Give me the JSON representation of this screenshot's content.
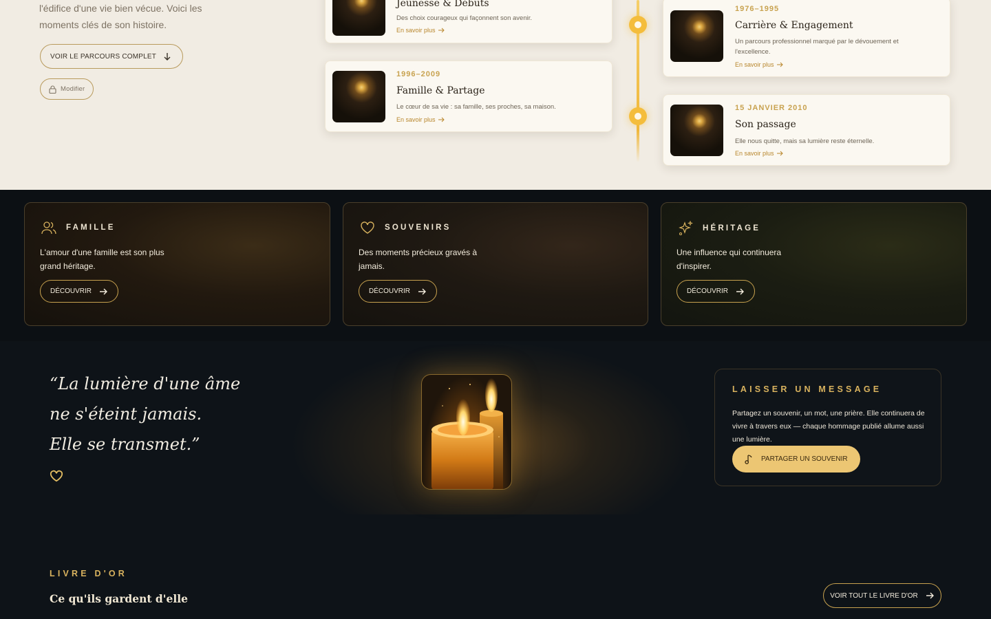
{
  "intro": {
    "text": "l'édifice d'une vie bien vécue. Voici les moments clés de son histoire."
  },
  "actions": {
    "parcours_label": "VOIR LE PARCOURS COMPLET",
    "modifier_label": "Modifier"
  },
  "timeline": {
    "more_label": "En savoir plus",
    "left": [
      {
        "title": "Jeunesse & Débuts",
        "desc": "Des choix courageux qui façonnent son avenir."
      },
      {
        "date": "1996–2009",
        "title": "Famille & Partage",
        "desc": "Le cœur de sa vie : sa famille, ses proches, sa maison."
      }
    ],
    "right": [
      {
        "date": "1976–1995",
        "title": "Carrière & Engagement",
        "desc": "Un parcours professionnel marqué par le dévouement et l'excellence."
      },
      {
        "date": "15 JANVIER 2010",
        "title": "Son passage",
        "desc": "Elle nous quitte, mais sa lumière reste éternelle."
      }
    ]
  },
  "features": {
    "button_label": "DÉCOUVRIR",
    "items": [
      {
        "label": "FAMILLE",
        "icon": "users-icon",
        "text": "L'amour d'une famille est son plus grand héritage."
      },
      {
        "label": "SOUVENIRS",
        "icon": "heart-icon",
        "text": "Des moments précieux gravés à jamais."
      },
      {
        "label": "HÉRITAGE",
        "icon": "sparkles-icon",
        "text": "Une influence qui continuera d'inspirer."
      }
    ]
  },
  "quote": {
    "text": "“La lumière d'une âme\nne s'éteint jamais.\nElle se transmet.”"
  },
  "message": {
    "title": "LAISSER UN MESSAGE",
    "text": "Partagez un souvenir, un mot, une prière. Elle continuera de vivre à travers eux — chaque hommage publié allume aussi une lumière.",
    "button_label": "PARTAGER UN SOUVENIR"
  },
  "livre": {
    "label": "LIVRE D'OR",
    "title": "Ce qu'ils gardent d'elle",
    "button_label": "VOIR TOUT LE LIVRE D'OR"
  },
  "colors": {
    "gold": "#c8a24f",
    "cream": "#f1ece3",
    "dark": "#0e1318",
    "accent_button": "#ecc673"
  }
}
